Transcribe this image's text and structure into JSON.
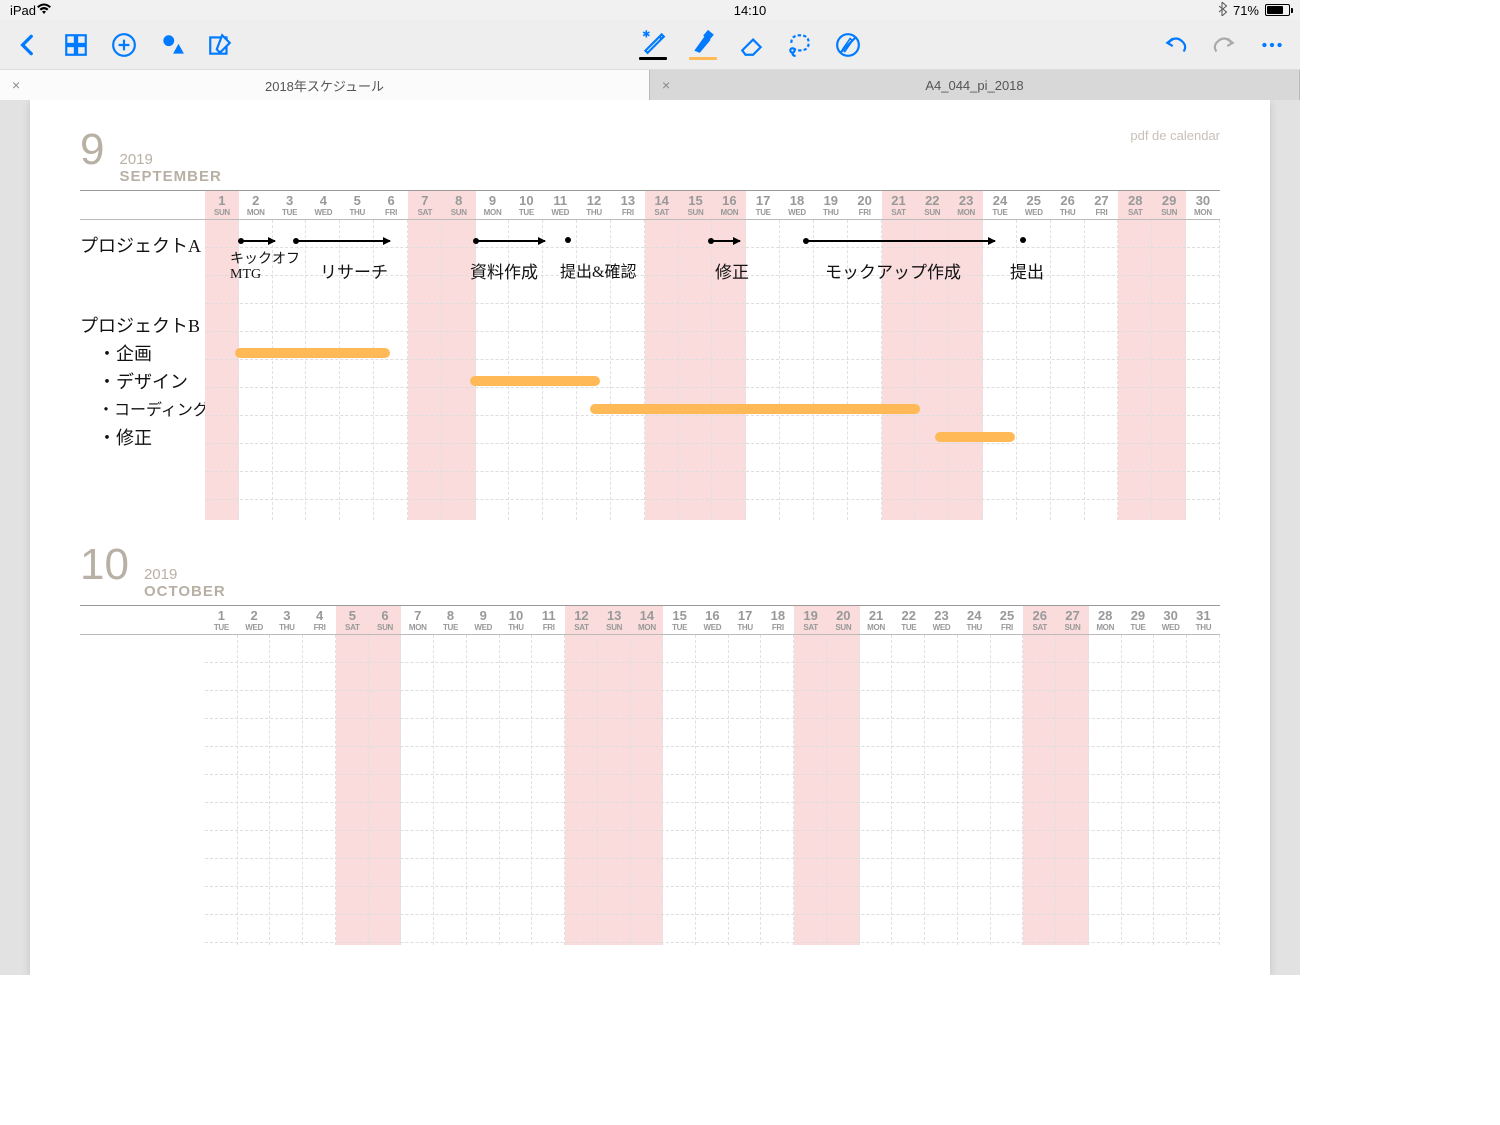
{
  "status": {
    "device": "iPad",
    "time": "14:10",
    "battery": "71%"
  },
  "tabs": [
    {
      "label": "2018年スケジュール",
      "active": true
    },
    {
      "label": "A4_044_pi_2018",
      "active": false
    }
  ],
  "watermark": "pdf de calendar",
  "months": [
    {
      "num": "9",
      "year": "2019",
      "name": "SEPTEMBER",
      "days": [
        {
          "d": "1",
          "w": "SUN",
          "we": true
        },
        {
          "d": "2",
          "w": "MON"
        },
        {
          "d": "3",
          "w": "TUE"
        },
        {
          "d": "4",
          "w": "WED"
        },
        {
          "d": "5",
          "w": "THU"
        },
        {
          "d": "6",
          "w": "FRI"
        },
        {
          "d": "7",
          "w": "SAT",
          "we": true
        },
        {
          "d": "8",
          "w": "SUN",
          "we": true
        },
        {
          "d": "9",
          "w": "MON"
        },
        {
          "d": "10",
          "w": "TUE"
        },
        {
          "d": "11",
          "w": "WED"
        },
        {
          "d": "12",
          "w": "THU"
        },
        {
          "d": "13",
          "w": "FRI"
        },
        {
          "d": "14",
          "w": "SAT",
          "we": true
        },
        {
          "d": "15",
          "w": "SUN",
          "we": true
        },
        {
          "d": "16",
          "w": "MON",
          "we": true
        },
        {
          "d": "17",
          "w": "TUE"
        },
        {
          "d": "18",
          "w": "WED"
        },
        {
          "d": "19",
          "w": "THU"
        },
        {
          "d": "20",
          "w": "FRI"
        },
        {
          "d": "21",
          "w": "SAT",
          "we": true
        },
        {
          "d": "22",
          "w": "SUN",
          "we": true
        },
        {
          "d": "23",
          "w": "MON",
          "we": true
        },
        {
          "d": "24",
          "w": "TUE"
        },
        {
          "d": "25",
          "w": "WED"
        },
        {
          "d": "26",
          "w": "THU"
        },
        {
          "d": "27",
          "w": "FRI"
        },
        {
          "d": "28",
          "w": "SAT",
          "we": true
        },
        {
          "d": "29",
          "w": "SUN",
          "we": true
        },
        {
          "d": "30",
          "w": "MON"
        }
      ]
    },
    {
      "num": "10",
      "year": "2019",
      "name": "OCTOBER",
      "days": [
        {
          "d": "1",
          "w": "TUE"
        },
        {
          "d": "2",
          "w": "WED"
        },
        {
          "d": "3",
          "w": "THU"
        },
        {
          "d": "4",
          "w": "FRI"
        },
        {
          "d": "5",
          "w": "SAT",
          "we": true
        },
        {
          "d": "6",
          "w": "SUN",
          "we": true
        },
        {
          "d": "7",
          "w": "MON"
        },
        {
          "d": "8",
          "w": "TUE"
        },
        {
          "d": "9",
          "w": "WED"
        },
        {
          "d": "10",
          "w": "THU"
        },
        {
          "d": "11",
          "w": "FRI"
        },
        {
          "d": "12",
          "w": "SAT",
          "we": true
        },
        {
          "d": "13",
          "w": "SUN",
          "we": true
        },
        {
          "d": "14",
          "w": "MON",
          "we": true
        },
        {
          "d": "15",
          "w": "TUE"
        },
        {
          "d": "16",
          "w": "WED"
        },
        {
          "d": "17",
          "w": "THU"
        },
        {
          "d": "18",
          "w": "FRI"
        },
        {
          "d": "19",
          "w": "SAT",
          "we": true
        },
        {
          "d": "20",
          "w": "SUN",
          "we": true
        },
        {
          "d": "21",
          "w": "MON"
        },
        {
          "d": "22",
          "w": "TUE"
        },
        {
          "d": "23",
          "w": "WED"
        },
        {
          "d": "24",
          "w": "THU"
        },
        {
          "d": "25",
          "w": "FRI"
        },
        {
          "d": "26",
          "w": "SAT",
          "we": true
        },
        {
          "d": "27",
          "w": "SUN",
          "we": true
        },
        {
          "d": "28",
          "w": "MON"
        },
        {
          "d": "29",
          "w": "TUE"
        },
        {
          "d": "30",
          "w": "WED"
        },
        {
          "d": "31",
          "w": "THU"
        }
      ]
    }
  ],
  "annotations": {
    "project_a_label": "プロジェクトA",
    "kickoff": "キックオフ\nMTG",
    "research": "リサーチ",
    "materials": "資料作成",
    "confirm": "提出&確認",
    "fix": "修正",
    "mockup": "モックアップ作成",
    "submit": "提出",
    "project_b_label": "プロジェクトB",
    "plan": "・企画",
    "design": "・デザイン",
    "coding": "・コーディング",
    "fix2": "・修正"
  }
}
